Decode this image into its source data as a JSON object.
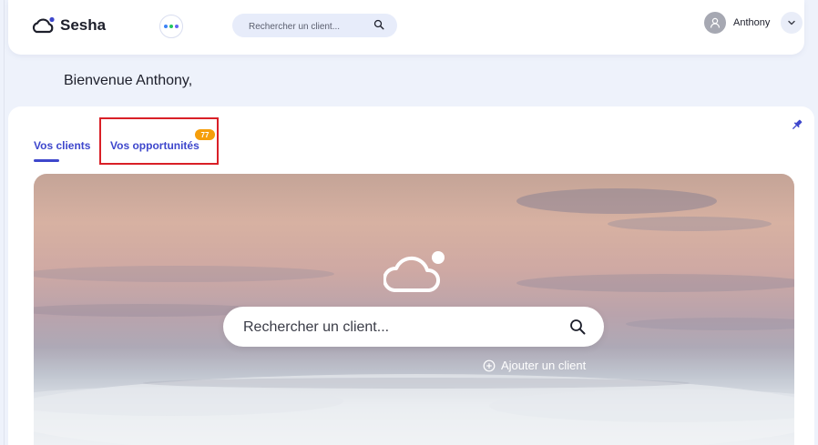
{
  "header": {
    "brand": "Sesha",
    "search_placeholder": "Rechercher un client...",
    "user_name": "Anthony",
    "apps_dot_colors": [
      "#3b82f6",
      "#22c55e",
      "#6366f1"
    ]
  },
  "welcome": "Bienvenue Anthony,",
  "tabs": [
    {
      "label": "Vos clients",
      "active": true
    },
    {
      "label": "Vos opportunités",
      "active": false,
      "badge": "77"
    }
  ],
  "hero": {
    "search_placeholder": "Rechercher un client...",
    "add_client_label": "Ajouter un client"
  },
  "colors": {
    "accent": "#3e47cc",
    "badge": "#f59e0b",
    "highlight_box": "#d92027"
  },
  "icons": [
    "cloud-logo-icon",
    "apps-dots-icon",
    "search-icon",
    "user-avatar-icon",
    "chevron-down-icon",
    "pin-icon",
    "cloud-icon",
    "plus-circle-icon"
  ]
}
